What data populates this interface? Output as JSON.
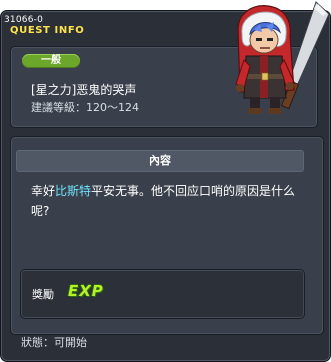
{
  "window": {
    "quest_id": "31066-0",
    "title": "QUEST INFO"
  },
  "quest": {
    "category": "一般",
    "name": "[星之力]恶鬼的哭声",
    "level_label": "建議等級：",
    "level_range": "120～124"
  },
  "content": {
    "header": "內容",
    "text_before": "幸好",
    "npc_name": "比斯特",
    "text_after": "平安无事。他不回应口哨的原因是什么呢?"
  },
  "reward": {
    "label": "獎勵",
    "exp_text": "EXP"
  },
  "status": {
    "label": "狀態：",
    "value": "可開始"
  },
  "colors": {
    "title": "#ffe34a",
    "category_badge": "#6ca62b",
    "npc_name": "#6fe3ff",
    "exp": "#b8f02a"
  },
  "icons": {
    "portrait": "npc-portrait"
  }
}
